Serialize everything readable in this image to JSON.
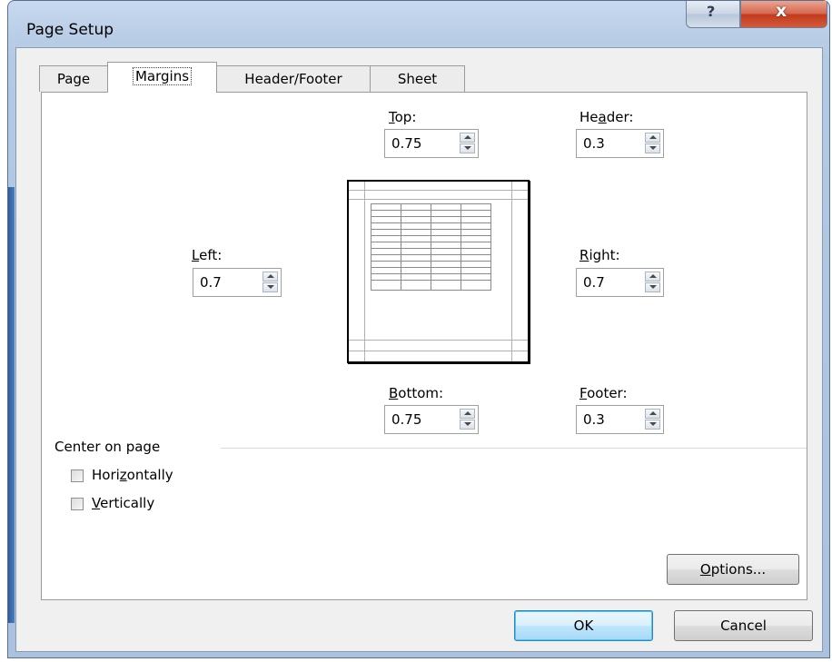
{
  "window": {
    "title": "Page Setup",
    "help_glyph": "?",
    "close_glyph": "x"
  },
  "tabs": [
    {
      "label": "Page"
    },
    {
      "label": "Margins",
      "active": true
    },
    {
      "label": "Header/Footer"
    },
    {
      "label": "Sheet"
    }
  ],
  "margins": {
    "top": {
      "label_pre": "",
      "label_u": "T",
      "label_post": "op:",
      "value": "0.75"
    },
    "header": {
      "label_pre": "He",
      "label_u": "a",
      "label_post": "der:",
      "value": "0.3"
    },
    "left": {
      "label_pre": "",
      "label_u": "L",
      "label_post": "eft:",
      "value": "0.7"
    },
    "right": {
      "label_pre": "",
      "label_u": "R",
      "label_post": "ight:",
      "value": "0.7"
    },
    "bottom": {
      "label_pre": "",
      "label_u": "B",
      "label_post": "ottom:",
      "value": "0.75"
    },
    "footer": {
      "label_pre": "",
      "label_u": "F",
      "label_post": "ooter:",
      "value": "0.3"
    }
  },
  "center": {
    "group_label": "Center on page",
    "horizontally": {
      "pre": "Hori",
      "u": "z",
      "post": "ontally",
      "checked": false
    },
    "vertically": {
      "pre": "",
      "u": "V",
      "post": "ertically",
      "checked": false
    }
  },
  "buttons": {
    "options": {
      "pre": "",
      "u": "O",
      "post": "ptions..."
    },
    "ok": "OK",
    "cancel": "Cancel"
  },
  "colors": {
    "title_bar": "#b9cde6",
    "close": "#c23a1c",
    "dialog_bg": "#f0f0f0",
    "default_button": "#bee6fd"
  }
}
